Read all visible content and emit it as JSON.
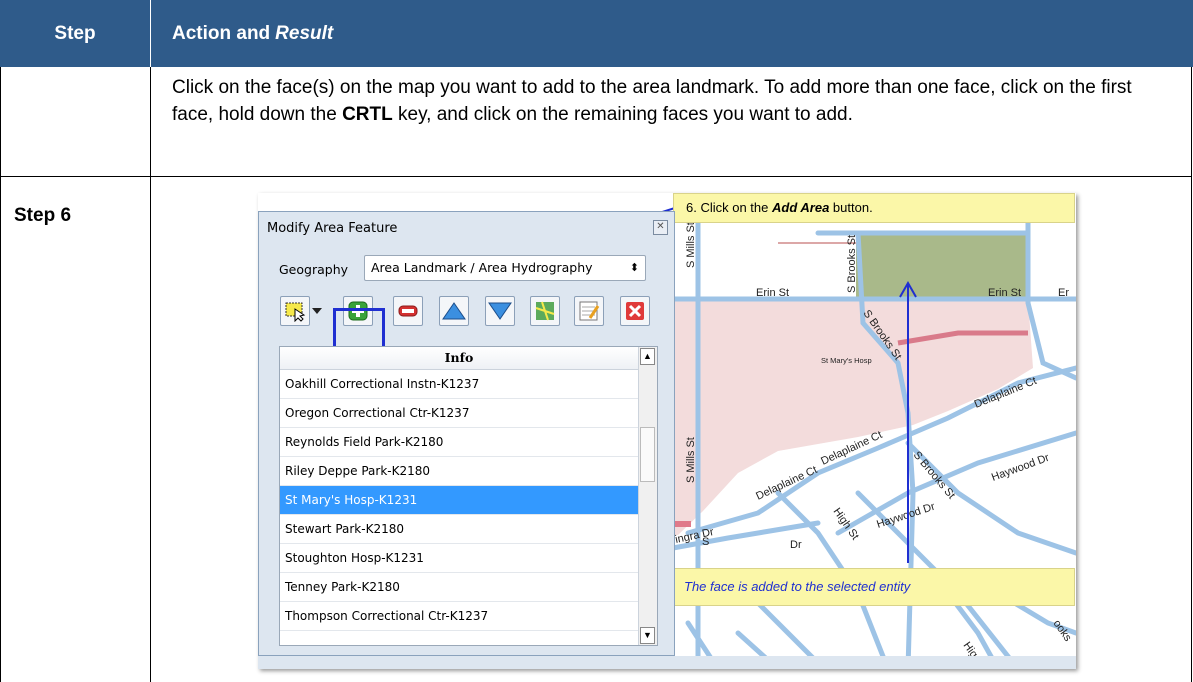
{
  "table": {
    "col_step": "Step",
    "col_action": "Action and",
    "col_result": "Result",
    "row1": {
      "text_a": "Click on the face(s) on the map you want to add to the area landmark. To add more than one face, click on the first face, hold down the ",
      "key": "CRTL",
      "text_b": " key, and click on the remaining faces you want to add."
    },
    "row2": {
      "step": "Step 6"
    }
  },
  "dialog": {
    "title": "Modify Area Feature",
    "geography_label": "Geography",
    "geography_value": "Area Landmark / Area Hydrography",
    "list_header": "Info",
    "items": [
      "Oakhill Correctional Instn-K1237",
      "Oregon Correctional Ctr-K1237",
      "Reynolds Field Park-K2180",
      "Riley Deppe Park-K2180",
      "St Mary's Hosp-K1231",
      "Stewart Park-K2180",
      "Stoughton Hosp-K1231",
      "Tenney Park-K2180",
      "Thompson Correctional Ctr-K1237"
    ],
    "selected_item": "St Mary's Hosp-K1231"
  },
  "callouts": {
    "top_prefix": "6. Click on the ",
    "top_bold": "Add Area",
    "top_suffix": " button.",
    "bottom": "The face is added to the selected entity"
  },
  "map_labels": {
    "erin1": "Erin St",
    "erin2": "Erin St",
    "erin3": "Er",
    "brooks1": "S Brooks St",
    "brooks2": "S Brooks St",
    "brooks3": "S Brooks St",
    "mills1": "S Mills St",
    "mills2": "S Mills St",
    "hosp": "St Mary's Hosp",
    "delaplaine1": "Delaplaine Ct",
    "delaplaine2": "Delaplaine Ct",
    "delaplaine3": "Delaplaine Ct",
    "haywood1": "Haywood Dr",
    "haywood2": "Haywood Dr",
    "high1": "High St",
    "high2": "Hig",
    "ingra": "ingra Dr",
    "dr": "Dr",
    "ooks": "ooks",
    "s": "S"
  },
  "colors": {
    "header_bg": "#2f5b8a",
    "selection": "#3399ff",
    "highlight_area": "#aab88a",
    "face_fill": "#f5dede",
    "road": "#9dc3e6",
    "arrow": "#1f2fd1"
  }
}
